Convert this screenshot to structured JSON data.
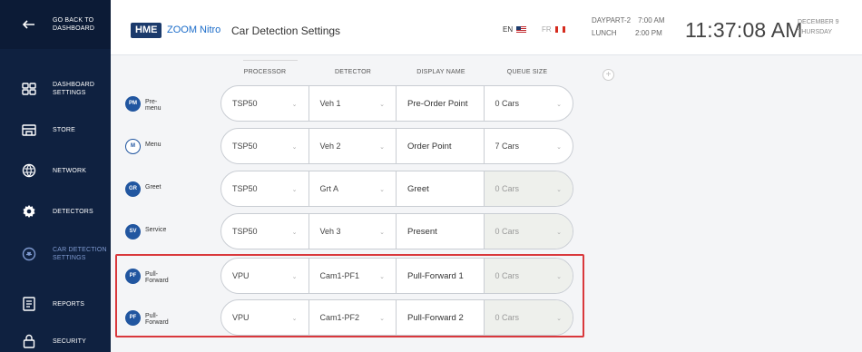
{
  "sidebar": {
    "back_label": "GO BACK TO\nDASHBOARD",
    "items": [
      {
        "label": "DASHBOARD\nSETTINGS",
        "icon": "dashboard-icon"
      },
      {
        "label": "STORE",
        "icon": "store-icon"
      },
      {
        "label": "NETWORK",
        "icon": "network-icon"
      },
      {
        "label": "DETECTORS",
        "icon": "gear-icon"
      },
      {
        "label": "CAR DETECTION\nSETTINGS",
        "icon": "car-detection-icon",
        "active": true
      },
      {
        "label": "REPORTS",
        "icon": "report-icon"
      },
      {
        "label": "SECURITY",
        "icon": "lock-icon"
      }
    ]
  },
  "header": {
    "logo_hme": "HME",
    "logo_zoom": "ZOOM Nitro",
    "title": "Car Detection Settings",
    "lang_en": "EN",
    "lang_fr": "FR",
    "daypart_label": "DAYPART-2",
    "daypart_start": "7:00 AM",
    "daypart_name": "LUNCH",
    "daypart_end": "2:00 PM",
    "clock": "11:37:08 AM",
    "date_line1": "DECEMBER 9",
    "date_line2": "THURSDAY"
  },
  "columns": {
    "processor": "PROCESSOR",
    "detector": "DETECTOR",
    "display_name": "DISPLAY NAME",
    "queue_size": "QUEUE SIZE",
    "add_label": "+"
  },
  "lanes": [
    {
      "badge": "PM",
      "name": "Pre-menu",
      "processor": "TSP50",
      "detector": "Veh 1",
      "display": "Pre-Order Point",
      "queue": "0 Cars",
      "queue_enabled": true
    },
    {
      "badge": "M",
      "name": "Menu",
      "processor": "TSP50",
      "detector": "Veh 2",
      "display": "Order Point",
      "queue": "7 Cars",
      "queue_enabled": true
    },
    {
      "badge": "GR",
      "name": "Greet",
      "processor": "TSP50",
      "detector": "Grt A",
      "display": "Greet",
      "queue": "0 Cars",
      "queue_enabled": false
    },
    {
      "badge": "SV",
      "name": "Service",
      "processor": "TSP50",
      "detector": "Veh 3",
      "display": "Present",
      "queue": "0 Cars",
      "queue_enabled": false
    },
    {
      "badge": "PF",
      "name": "Pull-Forward",
      "processor": "VPU",
      "detector": "Cam1-PF1",
      "display": "Pull-Forward 1",
      "queue": "0 Cars",
      "queue_enabled": false
    },
    {
      "badge": "PF",
      "name": "Pull-Forward",
      "processor": "VPU",
      "detector": "Cam1-PF2",
      "display": "Pull-Forward 2",
      "queue": "0 Cars",
      "queue_enabled": false
    }
  ],
  "colors": {
    "sidebar_bg": "#0f2140",
    "brand_blue": "#2156a0",
    "highlight_red": "#d9383c"
  }
}
